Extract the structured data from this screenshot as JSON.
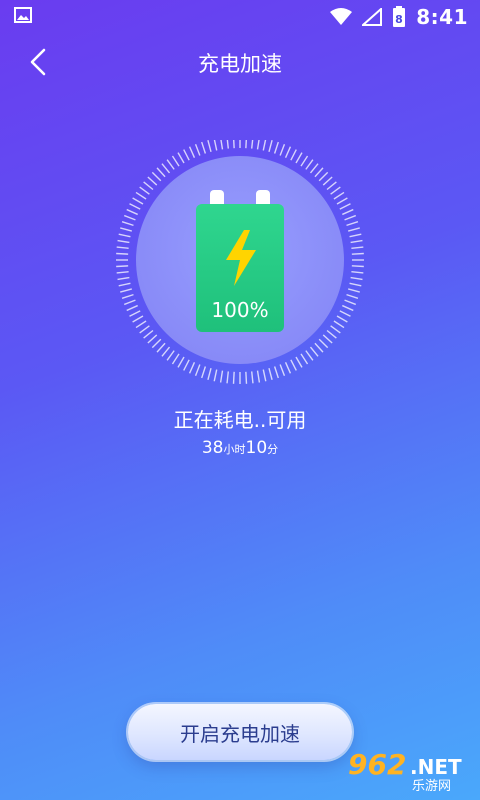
{
  "status_bar": {
    "time": "8:41",
    "battery_level": "8"
  },
  "header": {
    "title": "充电加速"
  },
  "battery": {
    "percent": "100%",
    "level": 1.0
  },
  "status": {
    "text": "正在耗电..可用",
    "hours": "38",
    "hours_unit": "小时",
    "minutes": "10",
    "minutes_unit": "分"
  },
  "actions": {
    "accelerate_label": "开启充电加速"
  },
  "watermark": {
    "number": "962",
    "suffix": ".NET",
    "subtitle": "乐游网"
  },
  "colors": {
    "bg_start": "#6a3cf0",
    "bg_end": "#4aa8fb",
    "battery_green": "#2ecf8a",
    "bolt_yellow": "#ffd400",
    "button_text": "#2b3d8f"
  }
}
